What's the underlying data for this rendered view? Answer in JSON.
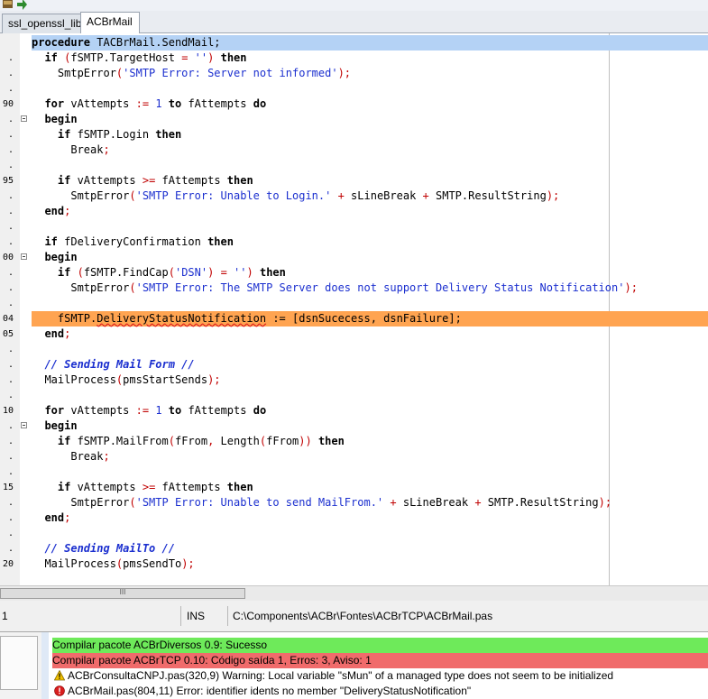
{
  "tabs": [
    {
      "label": "ssl_openssl_lib",
      "active": false
    },
    {
      "label": "ACBrMail",
      "active": true
    }
  ],
  "editor": {
    "lines": [
      {
        "ln": "",
        "fold": false,
        "hl": "blue",
        "segs": [
          [
            "procedure",
            "kw"
          ],
          [
            " TACBrMail.SendMail;",
            ""
          ]
        ]
      },
      {
        "ln": ".",
        "fold": false,
        "hl": "",
        "segs": [
          [
            "  ",
            ""
          ],
          [
            "if",
            "kw"
          ],
          [
            " ",
            ""
          ],
          [
            "(",
            "sym"
          ],
          [
            "fSMTP.TargetHost ",
            ""
          ],
          [
            "=",
            "sym"
          ],
          [
            " ",
            ""
          ],
          [
            "''",
            "str"
          ],
          [
            ")",
            "sym"
          ],
          [
            " ",
            ""
          ],
          [
            "then",
            "kw"
          ]
        ]
      },
      {
        "ln": ".",
        "fold": false,
        "hl": "",
        "segs": [
          [
            "    SmtpError",
            ""
          ],
          [
            "(",
            "sym"
          ],
          [
            "'SMTP Error: Server not informed'",
            "str"
          ],
          [
            ");",
            "sym"
          ]
        ]
      },
      {
        "ln": ".",
        "fold": false,
        "hl": "",
        "segs": []
      },
      {
        "ln": "90",
        "fold": false,
        "hl": "",
        "segs": [
          [
            "  ",
            ""
          ],
          [
            "for",
            "kw"
          ],
          [
            " vAttempts ",
            ""
          ],
          [
            ":=",
            "sym"
          ],
          [
            " ",
            ""
          ],
          [
            "1",
            "num"
          ],
          [
            " ",
            ""
          ],
          [
            "to",
            "kw"
          ],
          [
            " fAttempts ",
            ""
          ],
          [
            "do",
            "kw"
          ]
        ]
      },
      {
        "ln": ".",
        "fold": true,
        "hl": "",
        "segs": [
          [
            "  ",
            ""
          ],
          [
            "begin",
            "kw"
          ]
        ]
      },
      {
        "ln": ".",
        "fold": false,
        "hl": "",
        "segs": [
          [
            "    ",
            ""
          ],
          [
            "if",
            "kw"
          ],
          [
            " fSMTP.Login ",
            ""
          ],
          [
            "then",
            "kw"
          ]
        ]
      },
      {
        "ln": ".",
        "fold": false,
        "hl": "",
        "segs": [
          [
            "      Break",
            ""
          ],
          [
            ";",
            "sym"
          ]
        ]
      },
      {
        "ln": ".",
        "fold": false,
        "hl": "",
        "segs": []
      },
      {
        "ln": "95",
        "fold": false,
        "hl": "",
        "segs": [
          [
            "    ",
            ""
          ],
          [
            "if",
            "kw"
          ],
          [
            " vAttempts ",
            ""
          ],
          [
            ">=",
            "sym"
          ],
          [
            " fAttempts ",
            ""
          ],
          [
            "then",
            "kw"
          ]
        ]
      },
      {
        "ln": ".",
        "fold": false,
        "hl": "",
        "segs": [
          [
            "      SmtpError",
            ""
          ],
          [
            "(",
            "sym"
          ],
          [
            "'SMTP Error: Unable to Login.'",
            "str"
          ],
          [
            " ",
            ""
          ],
          [
            "+",
            "sym"
          ],
          [
            " sLineBreak ",
            ""
          ],
          [
            "+",
            "sym"
          ],
          [
            " SMTP.ResultString",
            ""
          ],
          [
            ");",
            "sym"
          ]
        ]
      },
      {
        "ln": ".",
        "fold": false,
        "hl": "",
        "segs": [
          [
            "  ",
            ""
          ],
          [
            "end",
            "kw"
          ],
          [
            ";",
            "sym"
          ]
        ]
      },
      {
        "ln": ".",
        "fold": false,
        "hl": "",
        "segs": []
      },
      {
        "ln": ".",
        "fold": false,
        "hl": "",
        "segs": [
          [
            "  ",
            ""
          ],
          [
            "if",
            "kw"
          ],
          [
            " fDeliveryConfirmation ",
            ""
          ],
          [
            "then",
            "kw"
          ]
        ]
      },
      {
        "ln": "00",
        "fold": true,
        "hl": "",
        "segs": [
          [
            "  ",
            ""
          ],
          [
            "begin",
            "kw"
          ]
        ]
      },
      {
        "ln": ".",
        "fold": false,
        "hl": "",
        "segs": [
          [
            "    ",
            ""
          ],
          [
            "if",
            "kw"
          ],
          [
            " ",
            ""
          ],
          [
            "(",
            "sym"
          ],
          [
            "fSMTP.FindCap",
            ""
          ],
          [
            "(",
            "sym"
          ],
          [
            "'DSN'",
            "str"
          ],
          [
            ")",
            "sym"
          ],
          [
            " ",
            ""
          ],
          [
            "=",
            "sym"
          ],
          [
            " ",
            ""
          ],
          [
            "''",
            "str"
          ],
          [
            ")",
            "sym"
          ],
          [
            " ",
            ""
          ],
          [
            "then",
            "kw"
          ]
        ]
      },
      {
        "ln": ".",
        "fold": false,
        "hl": "",
        "segs": [
          [
            "      SmtpError",
            ""
          ],
          [
            "(",
            "sym"
          ],
          [
            "'SMTP Error: The SMTP Server does not support Delivery Status Notification'",
            "str"
          ],
          [
            ");",
            "sym"
          ]
        ]
      },
      {
        "ln": ".",
        "fold": false,
        "hl": "",
        "segs": []
      },
      {
        "ln": "04",
        "fold": false,
        "hl": "orange",
        "segs": [
          [
            "    fSMTP.",
            ""
          ],
          [
            "DeliveryStatusNotification",
            "err"
          ],
          [
            " := [dsnSucecess, dsnFailure];",
            ""
          ]
        ]
      },
      {
        "ln": "05",
        "fold": false,
        "hl": "",
        "segs": [
          [
            "  ",
            ""
          ],
          [
            "end",
            "kw"
          ],
          [
            ";",
            "sym"
          ]
        ]
      },
      {
        "ln": ".",
        "fold": false,
        "hl": "",
        "segs": []
      },
      {
        "ln": ".",
        "fold": false,
        "hl": "",
        "segs": [
          [
            "  ",
            ""
          ],
          [
            "// Sending Mail Form //",
            "cm"
          ]
        ]
      },
      {
        "ln": ".",
        "fold": false,
        "hl": "",
        "segs": [
          [
            "  MailProcess",
            ""
          ],
          [
            "(",
            "sym"
          ],
          [
            "pmsStartSends",
            ""
          ],
          [
            ");",
            "sym"
          ]
        ]
      },
      {
        "ln": ".",
        "fold": false,
        "hl": "",
        "segs": []
      },
      {
        "ln": "10",
        "fold": false,
        "hl": "",
        "segs": [
          [
            "  ",
            ""
          ],
          [
            "for",
            "kw"
          ],
          [
            " vAttempts ",
            ""
          ],
          [
            ":=",
            "sym"
          ],
          [
            " ",
            ""
          ],
          [
            "1",
            "num"
          ],
          [
            " ",
            ""
          ],
          [
            "to",
            "kw"
          ],
          [
            " fAttempts ",
            ""
          ],
          [
            "do",
            "kw"
          ]
        ]
      },
      {
        "ln": ".",
        "fold": true,
        "hl": "",
        "segs": [
          [
            "  ",
            ""
          ],
          [
            "begin",
            "kw"
          ]
        ]
      },
      {
        "ln": ".",
        "fold": false,
        "hl": "",
        "segs": [
          [
            "    ",
            ""
          ],
          [
            "if",
            "kw"
          ],
          [
            " fSMTP.MailFrom",
            ""
          ],
          [
            "(",
            "sym"
          ],
          [
            "fFrom",
            ""
          ],
          [
            ",",
            "sym"
          ],
          [
            " Length",
            ""
          ],
          [
            "(",
            "sym"
          ],
          [
            "fFrom",
            ""
          ],
          [
            "))",
            "sym"
          ],
          [
            " ",
            ""
          ],
          [
            "then",
            "kw"
          ]
        ]
      },
      {
        "ln": ".",
        "fold": false,
        "hl": "",
        "segs": [
          [
            "      Break",
            ""
          ],
          [
            ";",
            "sym"
          ]
        ]
      },
      {
        "ln": ".",
        "fold": false,
        "hl": "",
        "segs": []
      },
      {
        "ln": "15",
        "fold": false,
        "hl": "",
        "segs": [
          [
            "    ",
            ""
          ],
          [
            "if",
            "kw"
          ],
          [
            " vAttempts ",
            ""
          ],
          [
            ">=",
            "sym"
          ],
          [
            " fAttempts ",
            ""
          ],
          [
            "then",
            "kw"
          ]
        ]
      },
      {
        "ln": ".",
        "fold": false,
        "hl": "",
        "segs": [
          [
            "      SmtpError",
            ""
          ],
          [
            "(",
            "sym"
          ],
          [
            "'SMTP Error: Unable to send MailFrom.'",
            "str"
          ],
          [
            " ",
            ""
          ],
          [
            "+",
            "sym"
          ],
          [
            " sLineBreak ",
            ""
          ],
          [
            "+",
            "sym"
          ],
          [
            " SMTP.ResultString",
            ""
          ],
          [
            ");",
            "sym"
          ]
        ]
      },
      {
        "ln": ".",
        "fold": false,
        "hl": "",
        "segs": [
          [
            "  ",
            ""
          ],
          [
            "end",
            "kw"
          ],
          [
            ";",
            "sym"
          ]
        ]
      },
      {
        "ln": ".",
        "fold": false,
        "hl": "",
        "segs": []
      },
      {
        "ln": ".",
        "fold": false,
        "hl": "",
        "segs": [
          [
            "  ",
            ""
          ],
          [
            "// Sending MailTo //",
            "cm"
          ]
        ]
      },
      {
        "ln": "20",
        "fold": false,
        "hl": "",
        "segs": [
          [
            "  MailProcess",
            ""
          ],
          [
            "(",
            "sym"
          ],
          [
            "pmsSendTo",
            ""
          ],
          [
            ");",
            "sym"
          ]
        ]
      }
    ]
  },
  "scrollbar": {
    "thumb_grip": "III"
  },
  "status": {
    "line_col": "1",
    "mode": "INS",
    "file_path": "C:\\Components\\ACBr\\Fontes\\ACBrTCP\\ACBrMail.pas"
  },
  "messages": {
    "items": [
      {
        "text": "Compilar pacote ACBrDiversos 0.9: Sucesso",
        "kind": "ok",
        "icon": ""
      },
      {
        "text": "Compilar pacote ACBrTCP 0.10: Código saída 1, Erros: 3, Aviso: 1",
        "kind": "bad",
        "icon": ""
      },
      {
        "text": "ACBrConsultaCNPJ.pas(320,9) Warning: Local variable \"sMun\" of a managed type does not seem to be initialized",
        "kind": "warn",
        "icon": "warning-icon"
      },
      {
        "text": "ACBrMail.pas(804,11) Error: identifier idents no member \"DeliveryStatusNotification\"",
        "kind": "error",
        "icon": "error-icon"
      }
    ]
  },
  "colors": {
    "current_line": "#b4d2f5",
    "error_line": "#ffa451",
    "ok_message": "#6eea5a",
    "bad_message": "#f06b6b",
    "string": "#1b2fcf",
    "symbol": "#c00000"
  }
}
